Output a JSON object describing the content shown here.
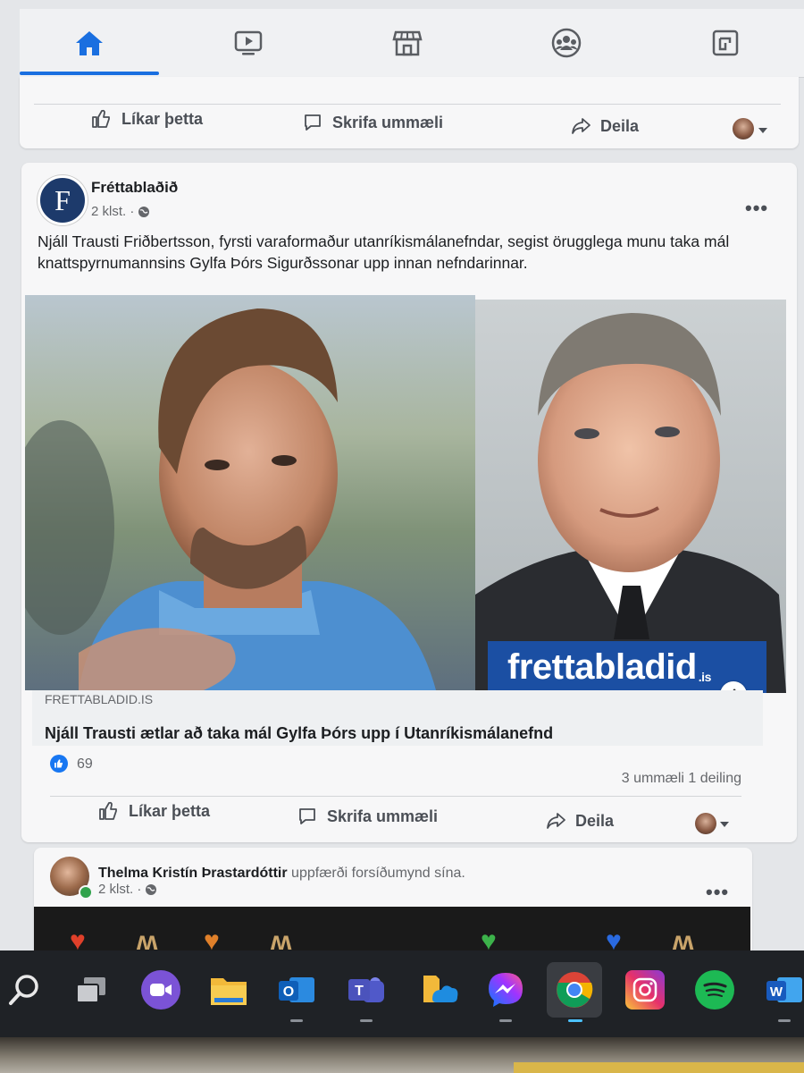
{
  "nav": {
    "tabs": [
      {
        "icon": "home-icon",
        "active": true
      },
      {
        "icon": "video-icon",
        "active": false
      },
      {
        "icon": "marketplace-icon",
        "active": false
      },
      {
        "icon": "groups-icon",
        "active": false
      },
      {
        "icon": "gaming-icon",
        "active": false
      }
    ]
  },
  "prev_post": {
    "like_label": "Líkar þetta",
    "comment_label": "Skrifa ummæli",
    "share_label": "Deila"
  },
  "post": {
    "page_avatar_letter": "F",
    "page_name": "Fréttablaðið",
    "time": "2 klst. ·",
    "text": "Njáll Trausti Friðbertsson, fyrsti varaformaður utanríkismálanefndar, segist örugglega munu taka mál knattspyrnumannsins Gylfa Þórs Sigurðssonar upp innan nefndarinnar.",
    "image_brand": "frettabladid",
    "image_brand_suffix": ".is",
    "link_domain": "FRETTABLADID.IS",
    "link_title": "Njáll Trausti ætlar að taka mál Gylfa Þórs upp í Utanríkismálanefnd",
    "like_count": "69",
    "stats": "3 ummæli  1 deiling",
    "like_label": "Líkar þetta",
    "comment_label": "Skrifa ummæli",
    "share_label": "Deila"
  },
  "next_post": {
    "user_name": "Thelma Kristín Þrastardóttir",
    "action_text": " uppfærði forsíðumynd sína.",
    "time": "2 klst. ·"
  },
  "taskbar": {
    "icons": [
      "search-icon",
      "task-view-icon",
      "zoom-icon",
      "file-explorer-icon",
      "outlook-icon",
      "teams-icon",
      "onedrive-icon",
      "messenger-icon",
      "chrome-icon",
      "instagram-icon",
      "spotify-icon",
      "word-icon"
    ],
    "outlook_letter": "O",
    "teams_letter": "T",
    "word_letter": "W"
  },
  "colors": {
    "accent": "#1877f2",
    "brand_banner": "#1b4fa3",
    "taskbar": "#1f2226"
  }
}
